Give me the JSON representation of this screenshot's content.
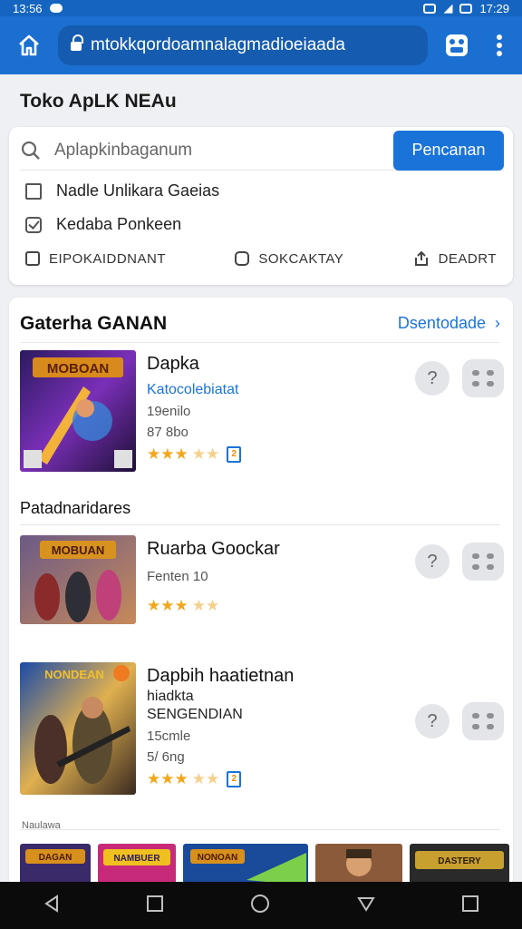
{
  "status_bar": {
    "time_left": "13:56",
    "time_right": "17:29"
  },
  "browser": {
    "url": "mtokkqordoamnalagmadioeiaada"
  },
  "page": {
    "title": "Toko ApLK NEAu"
  },
  "search": {
    "placeholder": "Aplapkinbaganum",
    "button_label": "Pencanan",
    "filters": [
      {
        "label": "Nadle Unlikara Gaeias",
        "checked": false
      },
      {
        "label": "Kedaba Ponkeen",
        "checked": true
      }
    ],
    "actions": [
      "EIPOKAIDDNANT",
      "SOKCAKTAY",
      "DEADRT"
    ]
  },
  "section": {
    "title": "Gaterha GANAN",
    "link_label": "Dsentodade"
  },
  "apps": [
    {
      "name": "Dapka",
      "developer": "Katocolebiatat",
      "meta1": "19enilo",
      "meta2": "87 8bo",
      "rating": 3.5,
      "has_badge": true
    },
    {
      "name": "Ruarba Goockar",
      "developer": "",
      "meta1": "Fenten 10",
      "meta2": "",
      "rating": 3.5,
      "has_badge": false
    },
    {
      "name": "Dapbih haatietnan",
      "developer": "",
      "meta1": "hiadkta",
      "meta2": "SENGENDIAN",
      "meta3": "15cmle",
      "meta4": "5/ 6ng",
      "rating": 3.5,
      "has_badge": true
    }
  ],
  "sub_section": {
    "title": "Patadnaridares"
  },
  "strip_label": "Naulawa",
  "thumb_titles": [
    "MOBOAN",
    "MOBUAN",
    "NONDEAN"
  ],
  "strip_titles": [
    "DAGAN",
    "NAMBUER",
    "NONOAN",
    "",
    "DASTERY"
  ],
  "colors": {
    "primary": "#1a73d9",
    "header": "#1a6fd0",
    "star": "#f2a71b"
  }
}
